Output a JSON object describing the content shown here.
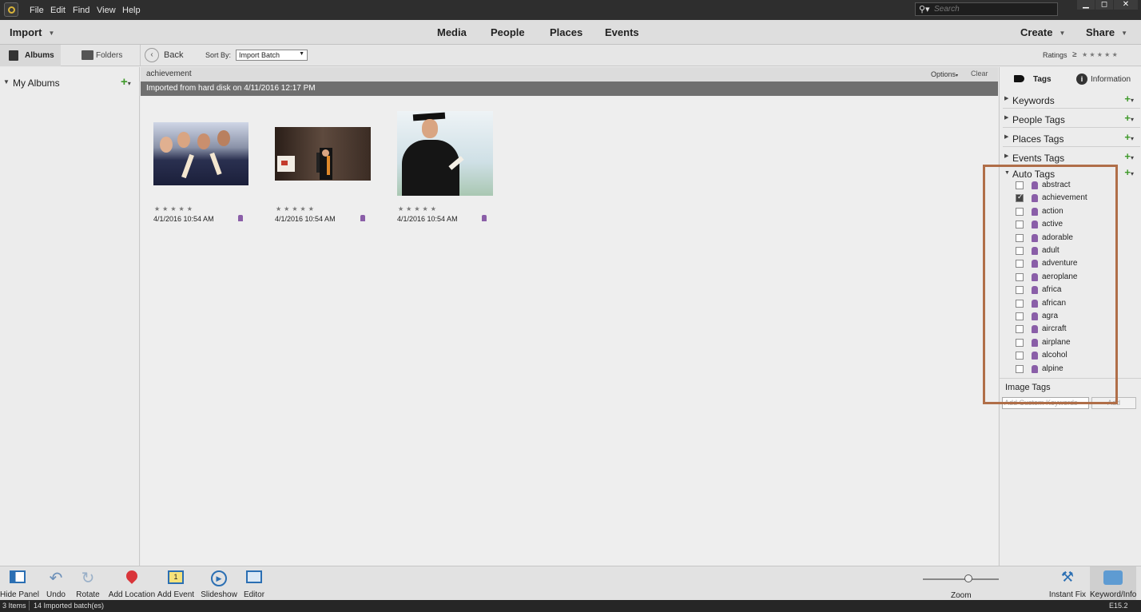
{
  "menu": [
    "File",
    "Edit",
    "Find",
    "View",
    "Help"
  ],
  "search_placeholder": "Search",
  "nav": {
    "import": "Import",
    "tabs": [
      "Media",
      "People",
      "Places",
      "Events"
    ],
    "create": "Create",
    "share": "Share"
  },
  "sidebar_tabs": {
    "albums": "Albums",
    "folders": "Folders"
  },
  "toolbar": {
    "back": "Back",
    "sort_by_label": "Sort By:",
    "sort_by_value": "Import Batch",
    "ratings": "Ratings",
    "ratings_op": "≥",
    "stars": "★ ★ ★ ★ ★"
  },
  "left": {
    "my_albums": "My Albums"
  },
  "content": {
    "filter_tag": "achievement",
    "options": "Options",
    "clear": "Clear",
    "batch_header": "Imported from hard disk on 4/11/2016 12:17 PM",
    "items": [
      {
        "stars": "★★★★★",
        "date": "4/1/2016 10:54 AM"
      },
      {
        "stars": "★★★★★",
        "date": "4/1/2016 10:54 AM"
      },
      {
        "stars": "★★★★★",
        "date": "4/1/2016 10:54 AM"
      }
    ]
  },
  "right": {
    "tab_tags": "Tags",
    "tab_info": "Information",
    "sections": [
      "Keywords",
      "People Tags",
      "Places Tags",
      "Events Tags"
    ],
    "auto_tags": "Auto Tags",
    "auto_tag_list": [
      {
        "label": "abstract",
        "checked": false
      },
      {
        "label": "achievement",
        "checked": true
      },
      {
        "label": "action",
        "checked": false
      },
      {
        "label": "active",
        "checked": false
      },
      {
        "label": "adorable",
        "checked": false
      },
      {
        "label": "adult",
        "checked": false
      },
      {
        "label": "adventure",
        "checked": false
      },
      {
        "label": "aeroplane",
        "checked": false
      },
      {
        "label": "africa",
        "checked": false
      },
      {
        "label": "african",
        "checked": false
      },
      {
        "label": "agra",
        "checked": false
      },
      {
        "label": "aircraft",
        "checked": false
      },
      {
        "label": "airplane",
        "checked": false
      },
      {
        "label": "alcohol",
        "checked": false
      },
      {
        "label": "alpine",
        "checked": false
      }
    ],
    "image_tags": "Image Tags",
    "keyword_placeholder": "Add Custom Keywords",
    "add_button": "Add"
  },
  "bottom": {
    "tools": [
      "Hide Panel",
      "Undo",
      "Rotate",
      "Add Location",
      "Add Event",
      "Slideshow",
      "Editor"
    ],
    "zoom": "Zoom",
    "instant_fix": "Instant Fix",
    "keyword_info": "Keyword/Info"
  },
  "status": {
    "items": "3 Items",
    "batches": "14 Imported batch(es)",
    "version": "E15.2"
  }
}
